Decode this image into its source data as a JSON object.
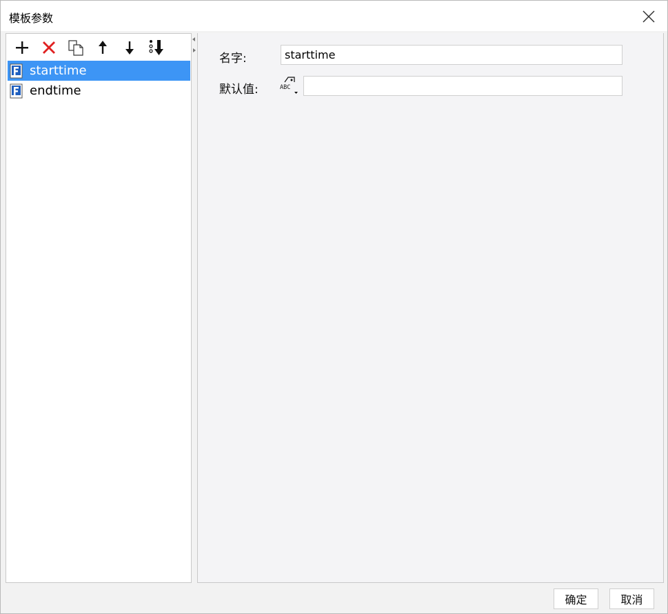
{
  "window": {
    "title": "模板参数",
    "close_icon": "close-icon"
  },
  "toolbar": {
    "buttons": [
      {
        "icon": "add-icon",
        "color": "#111111"
      },
      {
        "icon": "delete-icon",
        "color": "#e02020"
      },
      {
        "icon": "copy-icon",
        "color": "#333333"
      },
      {
        "icon": "arrow-up-icon",
        "color": "#111111"
      },
      {
        "icon": "arrow-down-icon",
        "color": "#111111"
      },
      {
        "icon": "sort-icon",
        "color": "#111111"
      }
    ]
  },
  "parameters": [
    {
      "name": "starttime",
      "selected": true
    },
    {
      "name": "endtime",
      "selected": false
    }
  ],
  "form": {
    "name_label": "名字:",
    "name_value": "starttime",
    "default_label": "默认值:",
    "default_value": "",
    "type_icon": "abc-type-icon"
  },
  "footer": {
    "ok_label": "确定",
    "cancel_label": "取消"
  },
  "colors": {
    "selection": "#3d95f5",
    "panel_bg": "#f4f4f6",
    "accent_icon": "#1f5fbf"
  }
}
